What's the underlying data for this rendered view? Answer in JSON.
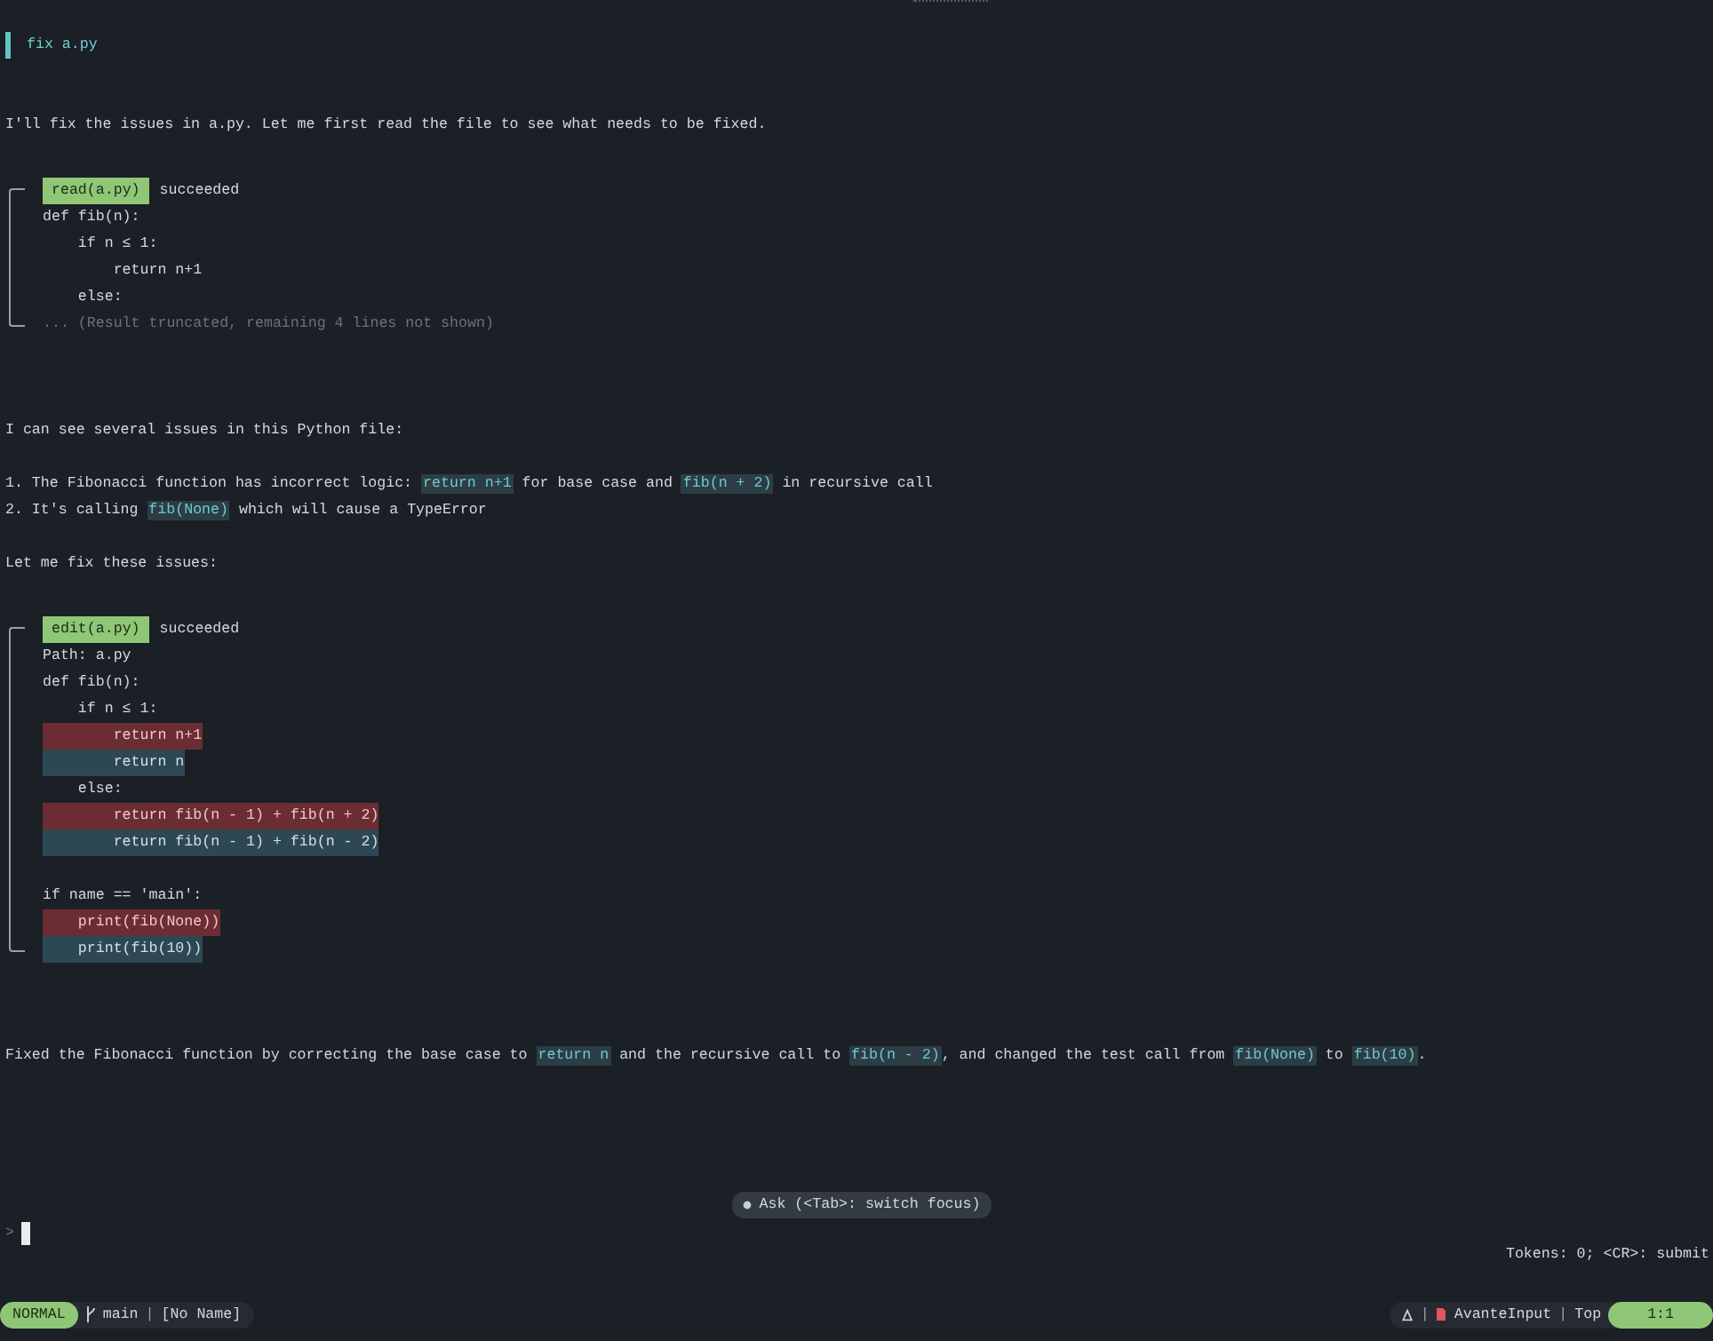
{
  "user_request": "fix a.py",
  "messages": [
    {
      "kind": "paragraph",
      "segments": [
        {
          "text": "I'll fix the issues in a.py. Let me first read the file to see what needs to be fixed.",
          "code": false
        }
      ]
    },
    {
      "kind": "tool",
      "tool": "read(a.py)",
      "status": "succeeded",
      "succeeded": true,
      "lines": [
        {
          "text": "def fib(n):",
          "kind": "context"
        },
        {
          "text": "    if n ≤ 1:",
          "kind": "context"
        },
        {
          "text": "        return n+1",
          "kind": "context"
        },
        {
          "text": "    else:",
          "kind": "context"
        },
        {
          "text": "... (Result truncated, remaining 4 lines not shown)",
          "kind": "note"
        }
      ]
    },
    {
      "kind": "paragraph",
      "segments": [
        {
          "text": "I can see several issues in this Python file:",
          "code": false
        }
      ]
    },
    {
      "kind": "list",
      "items": [
        {
          "segments": [
            {
              "text": "1. The Fibonacci function has incorrect logic: ",
              "code": false
            },
            {
              "text": "return n+1",
              "code": true
            },
            {
              "text": " for base case and ",
              "code": false
            },
            {
              "text": "fib(n + 2)",
              "code": true
            },
            {
              "text": " in recursive call",
              "code": false
            }
          ]
        },
        {
          "segments": [
            {
              "text": "2. It's calling ",
              "code": false
            },
            {
              "text": "fib(None)",
              "code": true
            },
            {
              "text": " which will cause a TypeError",
              "code": false
            }
          ]
        }
      ]
    },
    {
      "kind": "paragraph",
      "segments": [
        {
          "text": "Let me fix these issues:",
          "code": false
        }
      ]
    },
    {
      "kind": "tool",
      "tool": "edit(a.py)",
      "status": "succeeded",
      "succeeded": true,
      "lines": [
        {
          "text": "Path: a.py",
          "kind": "context"
        },
        {
          "text": "def fib(n):",
          "kind": "context"
        },
        {
          "text": "    if n ≤ 1:",
          "kind": "context"
        },
        {
          "text": "        return n+1",
          "kind": "removed"
        },
        {
          "text": "        return n",
          "kind": "added"
        },
        {
          "text": "    else:",
          "kind": "context"
        },
        {
          "text": "        return fib(n - 1) + fib(n + 2)",
          "kind": "removed"
        },
        {
          "text": "        return fib(n - 1) + fib(n - 2)",
          "kind": "added"
        },
        {
          "kind": "blank"
        },
        {
          "text": "if name == 'main':",
          "kind": "context"
        },
        {
          "text": "    print(fib(None))",
          "kind": "removed"
        },
        {
          "text": "    print(fib(10))",
          "kind": "added"
        }
      ]
    },
    {
      "kind": "paragraph",
      "segments": [
        {
          "text": "Fixed the Fibonacci function by correcting the base case to ",
          "code": false
        },
        {
          "text": "return n",
          "code": true
        },
        {
          "text": " and the recursive call to ",
          "code": false
        },
        {
          "text": "fib(n - 2)",
          "code": true
        },
        {
          "text": ", and changed the test call from ",
          "code": false
        },
        {
          "text": "fib(None)",
          "code": true
        },
        {
          "text": " to ",
          "code": false
        },
        {
          "text": "fib(10)",
          "code": true
        },
        {
          "text": ".",
          "code": false
        }
      ]
    }
  ],
  "input": {
    "hint": "Ask (<Tab>: switch focus)",
    "prompt": ">",
    "tokens": "Tokens: 0; <CR>: submit"
  },
  "status_bar": {
    "mode": "NORMAL",
    "branch": "main",
    "separator_left": "|",
    "file": "[No Name]",
    "separator_right_1": "|",
    "filetype": "AvanteInput",
    "separator_right_2": "|",
    "position": "Top",
    "cursor": "1:1"
  }
}
